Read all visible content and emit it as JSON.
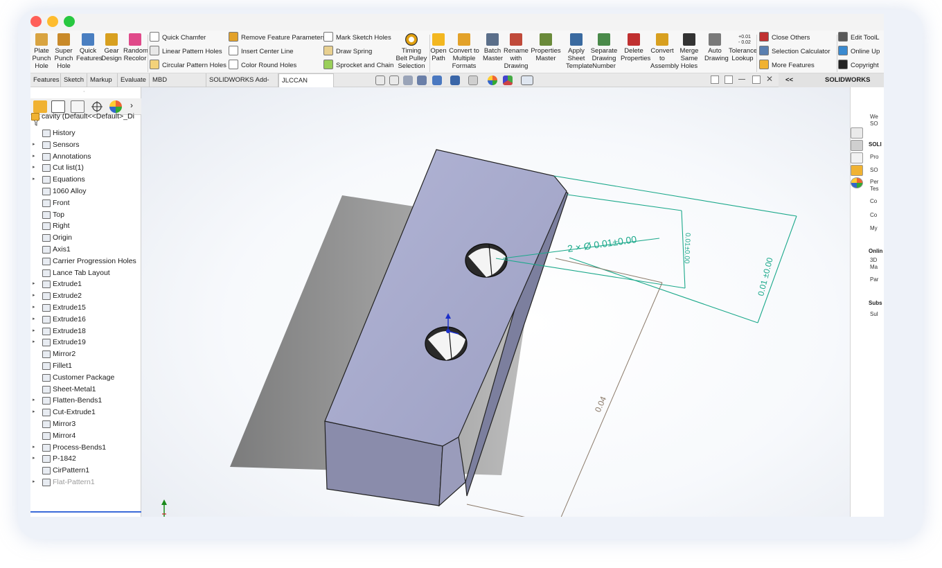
{
  "ribbon": {
    "big_buttons_left": [
      {
        "label": "Plate Punch Hole",
        "lines": [
          "Plate",
          "Punch",
          "Hole"
        ],
        "icon": "plate-punch-hole-icon",
        "color": "#d9a441"
      },
      {
        "label": "Super Punch Hole",
        "lines": [
          "Super",
          "Punch",
          "Hole"
        ],
        "icon": "super-punch-hole-icon",
        "color": "#c98a2a"
      },
      {
        "label": "Quick Features",
        "lines": [
          "Quick",
          "Features"
        ],
        "icon": "quick-features-icon",
        "color": "#4a7fc1"
      },
      {
        "label": "Gear Design",
        "lines": [
          "Gear",
          "Design"
        ],
        "icon": "gear-design-icon",
        "color": "#d8a020"
      },
      {
        "label": "Random Recolor",
        "lines": [
          "Random",
          "Recolor"
        ],
        "icon": "random-recolor-icon",
        "color": "#e04a8a"
      }
    ],
    "list_col1": [
      "Quick Chamfer",
      "Linear Pattern Holes",
      "Circular Pattern Holes"
    ],
    "list_col2": [
      "Remove Feature Parameters",
      "Insert Center Line",
      "Color Round Holes"
    ],
    "list_col3": [
      "Mark Sketch Holes",
      "Draw Spring",
      "Sprocket and Chain"
    ],
    "timing": {
      "lines": [
        "Timing",
        "Belt Pulley",
        "Selection"
      ]
    },
    "big_buttons_mid": [
      {
        "label": "Open Path",
        "lines": [
          "Open",
          "Path"
        ],
        "icon": "folder-icon",
        "color": "#f3b720"
      },
      {
        "label": "Convert to Multiple Formats",
        "lines": [
          "Convert to",
          "Multiple",
          "Formats"
        ],
        "icon": "convert-icon",
        "color": "#e3a22a"
      },
      {
        "label": "Batch Master",
        "lines": [
          "Batch",
          "Master"
        ],
        "icon": "batch-icon",
        "color": "#5b6f8a"
      },
      {
        "label": "Rename with Drawing",
        "lines": [
          "Rename",
          "with",
          "Drawing"
        ],
        "icon": "rename-icon",
        "color": "#c04a3a"
      },
      {
        "label": "Properties Master",
        "lines": [
          "Properties",
          "Master"
        ],
        "icon": "properties-icon",
        "color": "#6a8a3a"
      },
      {
        "label": "Apply Sheet Template",
        "lines": [
          "Apply",
          "Sheet",
          "Template"
        ],
        "icon": "sheet-template-icon",
        "color": "#3a6aa0"
      },
      {
        "label": "Separate Drawing Number",
        "lines": [
          "Separate",
          "Drawing",
          "Number"
        ],
        "icon": "separate-number-icon",
        "color": "#4a8a4a"
      },
      {
        "label": "Delete Properties",
        "lines": [
          "Delete",
          "Properties"
        ],
        "icon": "delete-properties-icon",
        "color": "#c03030"
      },
      {
        "label": "Convert to Assembly",
        "lines": [
          "Convert",
          "to",
          "Assembly"
        ],
        "icon": "assembly-icon",
        "color": "#d8a020"
      },
      {
        "label": "Merge Same Holes",
        "lines": [
          "Merge",
          "Same",
          "Holes"
        ],
        "icon": "merge-holes-icon",
        "color": "#333333"
      },
      {
        "label": "Auto Drawing",
        "lines": [
          "Auto",
          "Drawing"
        ],
        "icon": "auto-drawing-icon",
        "color": "#7a7a7a"
      },
      {
        "label": "Tolerance Lookup",
        "lines": [
          "Tolerance",
          "Lookup"
        ],
        "icon": "tolerance-icon",
        "color": "#333333"
      }
    ],
    "tolerance_badge": [
      "+0.01",
      "- 0.02"
    ],
    "list_col4": [
      "Close Others",
      "Selection Calculator",
      "More Features"
    ],
    "list_col5": [
      "Edit ToolL",
      "Online Up",
      "Copyright"
    ]
  },
  "tabs": [
    "Features",
    "Sketch",
    "Markup",
    "Evaluate",
    "MBD Dimensions",
    "SOLIDWORKS Add-Ins",
    "JLCCAN Toolbox"
  ],
  "active_tab": "JLCCAN Toolbox",
  "resources_pane": {
    "collapse": "<<",
    "title": "SOLIDWORKS Res"
  },
  "tree": {
    "root": "cavity  (Default<<Default>_Di",
    "items": [
      {
        "label": "History",
        "expand": false
      },
      {
        "label": "Sensors",
        "expand": true
      },
      {
        "label": "Annotations",
        "expand": true
      },
      {
        "label": "Cut list(1)",
        "expand": true
      },
      {
        "label": "Equations",
        "expand": true
      },
      {
        "label": "1060 Alloy",
        "expand": false
      },
      {
        "label": "Front",
        "expand": false
      },
      {
        "label": "Top",
        "expand": false
      },
      {
        "label": "Right",
        "expand": false
      },
      {
        "label": "Origin",
        "expand": false
      },
      {
        "label": "Axis1",
        "expand": false
      },
      {
        "label": "Carrier Progression Holes",
        "expand": false
      },
      {
        "label": "Lance Tab Layout",
        "expand": false
      },
      {
        "label": "Extrude1",
        "expand": true
      },
      {
        "label": "Extrude2",
        "expand": true
      },
      {
        "label": "Extrude15",
        "expand": true
      },
      {
        "label": "Extrude16",
        "expand": true
      },
      {
        "label": "Extrude18",
        "expand": true
      },
      {
        "label": "Extrude19",
        "expand": true
      },
      {
        "label": "Mirror2",
        "expand": false
      },
      {
        "label": "Fillet1",
        "expand": false
      },
      {
        "label": "Customer Package",
        "expand": false
      },
      {
        "label": "Sheet-Metal1",
        "expand": false
      },
      {
        "label": "Flatten-Bends1",
        "expand": true
      },
      {
        "label": "Cut-Extrude1",
        "expand": true
      },
      {
        "label": "Mirror3",
        "expand": false
      },
      {
        "label": "Mirror4",
        "expand": false
      },
      {
        "label": "Process-Bends1",
        "expand": true
      },
      {
        "label": "P-1842",
        "expand": true
      },
      {
        "label": "CirPattern1",
        "expand": false
      },
      {
        "label": "Flat-Pattern1",
        "expand": true,
        "dim": true
      }
    ]
  },
  "viewport": {
    "dims": {
      "hole_callout": "2 × Ø 0.01±0.00",
      "inner_vertical": "0.01±0.00",
      "outer_vertical": "0.01 ±0.00",
      "length": "0.04"
    },
    "colors": {
      "part_top": "#a5a8cc",
      "part_front": "#8a8cab",
      "part_side": "#7c7f9e",
      "dimension_green": "#1aa88a",
      "dimension_brown": "#8b7a6a"
    }
  },
  "taskpane": {
    "headers": [
      "SOLI",
      "Onlin",
      "Subs"
    ],
    "entries": [
      "We",
      "SO",
      "Pro",
      "SO",
      "Per",
      "Tes",
      "Co",
      "Co",
      "My",
      "3D",
      "Ma",
      "Par",
      "Sul"
    ]
  }
}
